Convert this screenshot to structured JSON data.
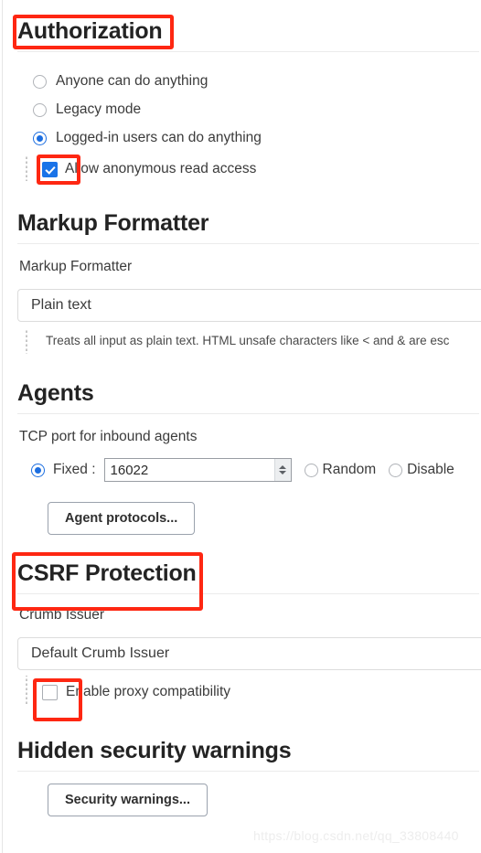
{
  "watermark": "https://blog.csdn.net/qq_33808440",
  "colors": {
    "accent_blue": "#1c6ee0",
    "checkbox_blue": "#1a73e8",
    "annotation_red": "#fe2712",
    "text": "#3b3b3b",
    "heading": "#232323"
  },
  "authorization": {
    "title": "Authorization",
    "options": [
      {
        "label": "Anyone can do anything",
        "selected": false
      },
      {
        "label": "Legacy mode",
        "selected": false
      },
      {
        "label": "Logged-in users can do anything",
        "selected": true
      }
    ],
    "sub_checkbox": {
      "label": "Allow anonymous read access",
      "checked": true
    }
  },
  "markup_formatter": {
    "title": "Markup Formatter",
    "field_label": "Markup Formatter",
    "selected_value": "Plain text",
    "help_text": "Treats all input as plain text. HTML unsafe characters like < and & are esc"
  },
  "agents": {
    "title": "Agents",
    "field_label": "TCP port for inbound agents",
    "fixed_label": "Fixed :",
    "fixed_selected": true,
    "port_value": "16022",
    "random_label": "Random",
    "random_selected": false,
    "disable_label": "Disable",
    "disable_selected": false,
    "protocols_button": "Agent protocols..."
  },
  "csrf": {
    "title": "CSRF Protection",
    "field_label": "Crumb Issuer",
    "selected_value": "Default Crumb Issuer",
    "proxy_checkbox": {
      "label": "Enable proxy compatibility",
      "checked": false
    }
  },
  "hidden_warnings": {
    "title": "Hidden security warnings",
    "button": "Security warnings..."
  }
}
